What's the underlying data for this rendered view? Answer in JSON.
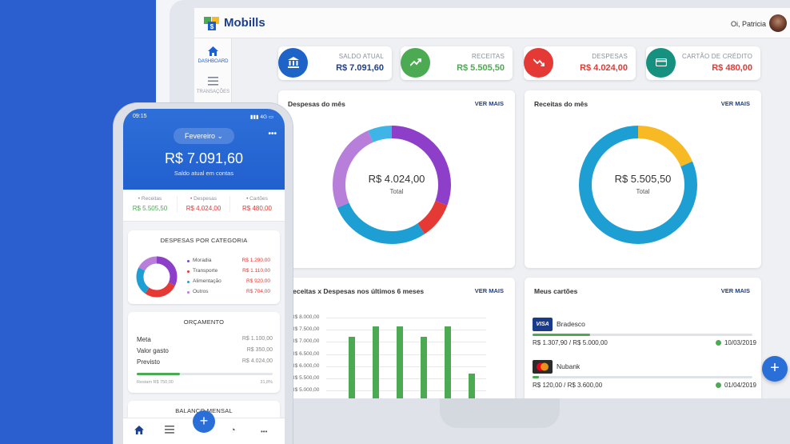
{
  "app": {
    "brand": "Mobills",
    "greeting": "Oi, Patricia"
  },
  "sidebar": {
    "items": [
      {
        "label": "DASHBOARD",
        "icon": "home-icon",
        "active": true
      },
      {
        "label": "TRANSAÇÕES",
        "icon": "list-icon",
        "active": false
      }
    ]
  },
  "stats": [
    {
      "label": "SALDO ATUAL",
      "value": "R$ 7.091,60",
      "icon": "bank-icon",
      "color": "#1e63c8"
    },
    {
      "label": "RECEITAS",
      "value": "R$ 5.505,50",
      "icon": "trend-up-icon",
      "color": "#4caa52"
    },
    {
      "label": "DESPESAS",
      "value": "R$ 4.024,00",
      "icon": "trend-down-icon",
      "color": "#e53935"
    },
    {
      "label": "CARTÃO DE CRÉDITO",
      "value": "R$ 480,00",
      "icon": "credit-card-icon",
      "color": "#16917f"
    }
  ],
  "expenses_card": {
    "title": "Despesas do mês",
    "link": "VER MAIS",
    "total": "R$ 4.024,00",
    "total_label": "Total"
  },
  "income_card": {
    "title": "Receitas do mês",
    "link": "VER MAIS",
    "total": "R$ 5.505,50",
    "total_label": "Total"
  },
  "bar_card": {
    "title": "Receitas x Despesas nos últimos 6 meses",
    "link": "VER MAIS"
  },
  "cards_card": {
    "title": "Meus cartões",
    "link": "VER MAIS",
    "cards": [
      {
        "name": "Bradesco",
        "logo": "visa-logo",
        "logo_text": "VISA",
        "amount": "R$ 1.307,90 / R$ 5.000,00",
        "date": "10/03/2019",
        "progress": 0.26
      },
      {
        "name": "Nubank",
        "logo": "mastercard-logo",
        "logo_text": "",
        "amount": "R$ 120,00 / R$ 3.600,00",
        "date": "01/04/2019",
        "progress": 0.03
      }
    ]
  },
  "chart_data": [
    {
      "type": "pie",
      "title": "Despesas do mês",
      "center_label": "R$ 4.024,00",
      "slices": [
        {
          "value": 1290,
          "color": "#8e3fc9"
        },
        {
          "value": 420,
          "color": "#e53935"
        },
        {
          "value": 1180,
          "color": "#1e9fd4"
        },
        {
          "value": 1040,
          "color": "#b77fd9"
        },
        {
          "value": 280,
          "color": "#3fb4e6"
        }
      ]
    },
    {
      "type": "pie",
      "title": "Receitas do mês",
      "center_label": "R$ 5.505,50",
      "slices": [
        {
          "value": 1020,
          "color": "#f7b924"
        },
        {
          "value": 4485.5,
          "color": "#1e9fd4"
        }
      ]
    },
    {
      "type": "bar",
      "title": "Receitas x Despesas nos últimos 6 meses",
      "yticks": [
        "R$ 8.000,00",
        "R$ 7.500,00",
        "R$ 7.000,00",
        "R$ 6.500,00",
        "R$ 6.000,00",
        "R$ 5.500,00",
        "R$ 5.000,00"
      ],
      "ylim": [
        5000,
        8000
      ],
      "values": [
        7200,
        7650,
        7650,
        7200,
        7650,
        5700
      ],
      "color": "#4caa52"
    }
  ],
  "phone": {
    "time": "09:15",
    "signal": "4G",
    "month": "Fevereiro",
    "balance": "R$ 7.091,60",
    "balance_label": "Saldo atual em contas",
    "summary": [
      {
        "label": "Receitas",
        "value": "R$ 5.505,50",
        "color": "#4caa52"
      },
      {
        "label": "Despesas",
        "value": "R$ 4.024,00",
        "color": "#e53935"
      },
      {
        "label": "Cartões",
        "value": "R$ 480,00",
        "color": "#e53935"
      }
    ],
    "category_title": "DESPESAS POR CATEGORIA",
    "categories": [
      {
        "name": "Moradia",
        "value": "R$ 1.290,00",
        "color": "#8e3fc9"
      },
      {
        "name": "Transporte",
        "value": "R$ 1.110,00",
        "color": "#e53935"
      },
      {
        "name": "Alimentação",
        "value": "R$ 920,00",
        "color": "#1e9fd4"
      },
      {
        "name": "Outros",
        "value": "R$ 704,00",
        "color": "#b77fd9"
      }
    ],
    "budget": {
      "title": "ORÇAMENTO",
      "rows": [
        {
          "label": "Meta",
          "value": "R$ 1.100,00"
        },
        {
          "label": "Valor gasto",
          "value": "R$ 350,00"
        },
        {
          "label": "Previsto",
          "value": "R$ 4.024,00"
        }
      ],
      "footer_left": "Restam R$ 750,00",
      "footer_right": "31,8%",
      "progress": 0.318
    },
    "monthly_title": "BALANÇO MENSAL"
  }
}
